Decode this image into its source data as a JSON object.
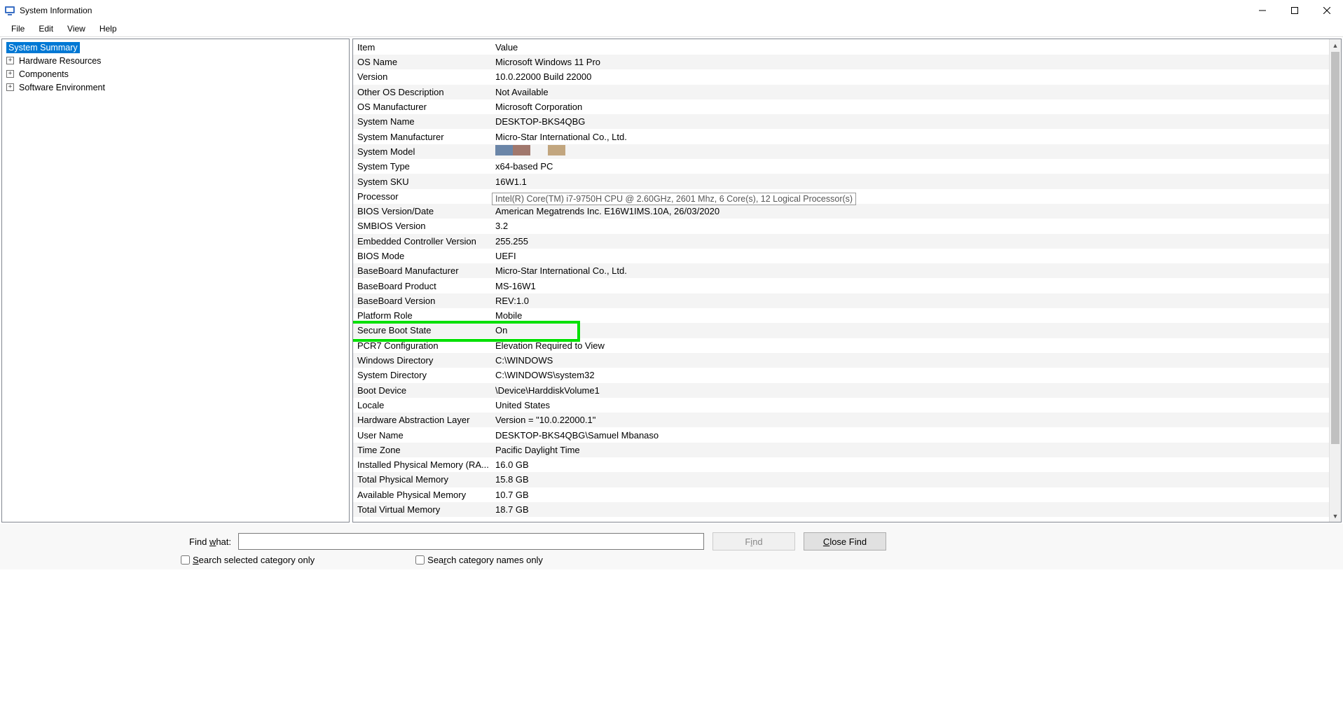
{
  "window": {
    "title": "System Information"
  },
  "menu": {
    "file": "File",
    "edit": "Edit",
    "view": "View",
    "help": "Help"
  },
  "tree": {
    "root": "System Summary",
    "children": [
      "Hardware Resources",
      "Components",
      "Software Environment"
    ]
  },
  "columns": {
    "item": "Item",
    "value": "Value"
  },
  "rows": [
    {
      "item": "OS Name",
      "value": "Microsoft Windows 11 Pro"
    },
    {
      "item": "Version",
      "value": "10.0.22000 Build 22000"
    },
    {
      "item": "Other OS Description",
      "value": "Not Available"
    },
    {
      "item": "OS Manufacturer",
      "value": "Microsoft Corporation"
    },
    {
      "item": "System Name",
      "value": "DESKTOP-BKS4QBG"
    },
    {
      "item": "System Manufacturer",
      "value": "Micro-Star International Co., Ltd."
    },
    {
      "item": "System Model",
      "value": ""
    },
    {
      "item": "System Type",
      "value": "x64-based PC"
    },
    {
      "item": "System SKU",
      "value": "16W1.1"
    },
    {
      "item": "Processor",
      "value": ""
    },
    {
      "item": "BIOS Version/Date",
      "value": "American Megatrends Inc. E16W1IMS.10A, 26/03/2020"
    },
    {
      "item": "SMBIOS Version",
      "value": "3.2"
    },
    {
      "item": "Embedded Controller Version",
      "value": "255.255"
    },
    {
      "item": "BIOS Mode",
      "value": "UEFI"
    },
    {
      "item": "BaseBoard Manufacturer",
      "value": "Micro-Star International Co., Ltd."
    },
    {
      "item": "BaseBoard Product",
      "value": "MS-16W1"
    },
    {
      "item": "BaseBoard Version",
      "value": "REV:1.0"
    },
    {
      "item": "Platform Role",
      "value": "Mobile"
    },
    {
      "item": "Secure Boot State",
      "value": "On"
    },
    {
      "item": "PCR7 Configuration",
      "value": "Elevation Required to View"
    },
    {
      "item": "Windows Directory",
      "value": "C:\\WINDOWS"
    },
    {
      "item": "System Directory",
      "value": "C:\\WINDOWS\\system32"
    },
    {
      "item": "Boot Device",
      "value": "\\Device\\HarddiskVolume1"
    },
    {
      "item": "Locale",
      "value": "United States"
    },
    {
      "item": "Hardware Abstraction Layer",
      "value": "Version = \"10.0.22000.1\""
    },
    {
      "item": "User Name",
      "value": "DESKTOP-BKS4QBG\\Samuel Mbanaso"
    },
    {
      "item": "Time Zone",
      "value": "Pacific Daylight Time"
    },
    {
      "item": "Installed Physical Memory (RA...",
      "value": "16.0 GB"
    },
    {
      "item": "Total Physical Memory",
      "value": "15.8 GB"
    },
    {
      "item": "Available Physical Memory",
      "value": "10.7 GB"
    },
    {
      "item": "Total Virtual Memory",
      "value": "18.7 GB"
    }
  ],
  "processor_tooltip": "Intel(R) Core(TM) i7-9750H CPU @ 2.60GHz, 2601 Mhz, 6 Core(s), 12 Logical Processor(s)",
  "model_swatch_colors": [
    "#6b86a8",
    "#a1786d",
    "transparent",
    "#c2a67f"
  ],
  "highlight_row_index": 18,
  "footer": {
    "find_label_pre": "Find ",
    "find_label_ul": "w",
    "find_label_post": "hat:",
    "find_button": "Find",
    "close_find_pre": "",
    "close_find_ul": "C",
    "close_find_post": "lose Find",
    "check1_pre": "",
    "check1_ul": "S",
    "check1_post": "earch selected category only",
    "check2_pre": "Sea",
    "check2_ul": "r",
    "check2_post": "ch category names only"
  }
}
